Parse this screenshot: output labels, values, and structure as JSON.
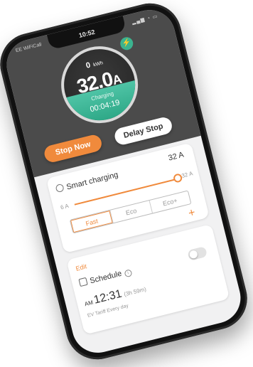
{
  "status_bar": {
    "carrier": "EE WiFiCall",
    "time": "10:52",
    "icons": "signal-wifi-battery"
  },
  "gauge": {
    "energy_value": "0",
    "energy_unit": "kWh",
    "current_value": "32.0",
    "current_unit": "A",
    "status": "Charging",
    "timer": "00:04:19"
  },
  "buttons": {
    "stop_now": "Stop Now",
    "delay_stop": "Delay Stop"
  },
  "smart_charging": {
    "title": "Smart charging",
    "current": "32 A",
    "slider_max_label": "32 A",
    "slider_min_label": "6 A",
    "slider_level": 1.0,
    "modes": [
      "Fast",
      "Eco",
      "Eco+"
    ],
    "selected_mode": "Fast",
    "add_symbol": "+"
  },
  "schedule": {
    "edit_label": "Edit",
    "title": "Schedule",
    "enabled": false,
    "time_prefix": "AM",
    "time": "12:31",
    "time_remaining": "(3h 59m)",
    "subtitle": "EV Tariff Every day"
  },
  "colors": {
    "accent": "#f08a3c",
    "charging_green": "#3bb38f",
    "header_bg": "#4b4b4b"
  }
}
